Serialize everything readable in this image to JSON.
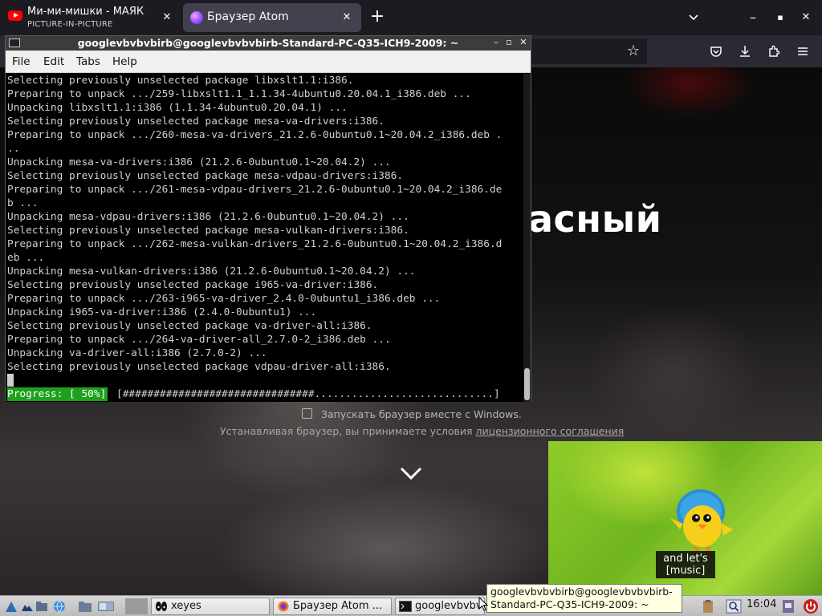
{
  "browser": {
    "tabs": [
      {
        "title": "Ми-ми-мишки - МАЯК - ",
        "subtitle": "PICTURE-IN-PICTURE",
        "icon": "youtube-icon"
      },
      {
        "title": "Браузер Atom",
        "icon": "atom-browser-icon",
        "active": true
      }
    ],
    "new_tab_label": "+",
    "window_controls": {
      "list_all": "⌄",
      "minimize": "–",
      "maximize": "▪",
      "close": "✕"
    }
  },
  "page": {
    "hero_text": "асный",
    "checkbox_label": "Запускать браузер вместе с Windows.",
    "checkbox_checked": false,
    "license_prefix": "Устанавливая браузер, вы принимаете условия ",
    "license_link": "лицензионного соглашения"
  },
  "pip": {
    "caption": "and let's [music]"
  },
  "terminal": {
    "title": "googlevbvbvbirb@googlevbvbvbirb-Standard-PC-Q35-ICH9-2009: ~",
    "menu": [
      "File",
      "Edit",
      "Tabs",
      "Help"
    ],
    "lines": [
      "Selecting previously unselected package libxslt1.1:i386.",
      "Preparing to unpack .../259-libxslt1.1_1.1.34-4ubuntu0.20.04.1_i386.deb ...",
      "Unpacking libxslt1.1:i386 (1.1.34-4ubuntu0.20.04.1) ...",
      "Selecting previously unselected package mesa-va-drivers:i386.",
      "Preparing to unpack .../260-mesa-va-drivers_21.2.6-0ubuntu0.1~20.04.2_i386.deb .",
      "..",
      "Unpacking mesa-va-drivers:i386 (21.2.6-0ubuntu0.1~20.04.2) ...",
      "Selecting previously unselected package mesa-vdpau-drivers:i386.",
      "Preparing to unpack .../261-mesa-vdpau-drivers_21.2.6-0ubuntu0.1~20.04.2_i386.de",
      "b ...",
      "Unpacking mesa-vdpau-drivers:i386 (21.2.6-0ubuntu0.1~20.04.2) ...",
      "Selecting previously unselected package mesa-vulkan-drivers:i386.",
      "Preparing to unpack .../262-mesa-vulkan-drivers_21.2.6-0ubuntu0.1~20.04.2_i386.d",
      "eb ...",
      "Unpacking mesa-vulkan-drivers:i386 (21.2.6-0ubuntu0.1~20.04.2) ...",
      "Selecting previously unselected package i965-va-driver:i386.",
      "Preparing to unpack .../263-i965-va-driver_2.4.0-0ubuntu1_i386.deb ...",
      "Unpacking i965-va-driver:i386 (2.4.0-0ubuntu1) ...",
      "Selecting previously unselected package va-driver-all:i386.",
      "Preparing to unpack .../264-va-driver-all_2.7.0-2_i386.deb ...",
      "Unpacking va-driver-all:i386 (2.7.0-2) ...",
      "Selecting previously unselected package vdpau-driver-all:i386."
    ],
    "progress_label": "Progress: [ 50%]",
    "progress_bar": "[###############################.............................]",
    "progress_percent": 50
  },
  "taskbar": {
    "tasks": [
      {
        "label": "xeyes",
        "icon": "xeyes-icon"
      },
      {
        "label": "Браузер Atom ...",
        "icon": "firefox-icon"
      },
      {
        "label": "googlevbvbv",
        "icon": "terminal-icon"
      }
    ],
    "clock": "16:04",
    "tooltip": "googlevbvbvbirb@googlevbvbvbirb-Standard-PC-Q35-ICH9-2009: ~"
  },
  "colors": {
    "tab_bg": "#1c1b22",
    "active_tab": "#42414d",
    "progress_green": "#1fa01f",
    "pip_green": "#8fcc2a"
  }
}
